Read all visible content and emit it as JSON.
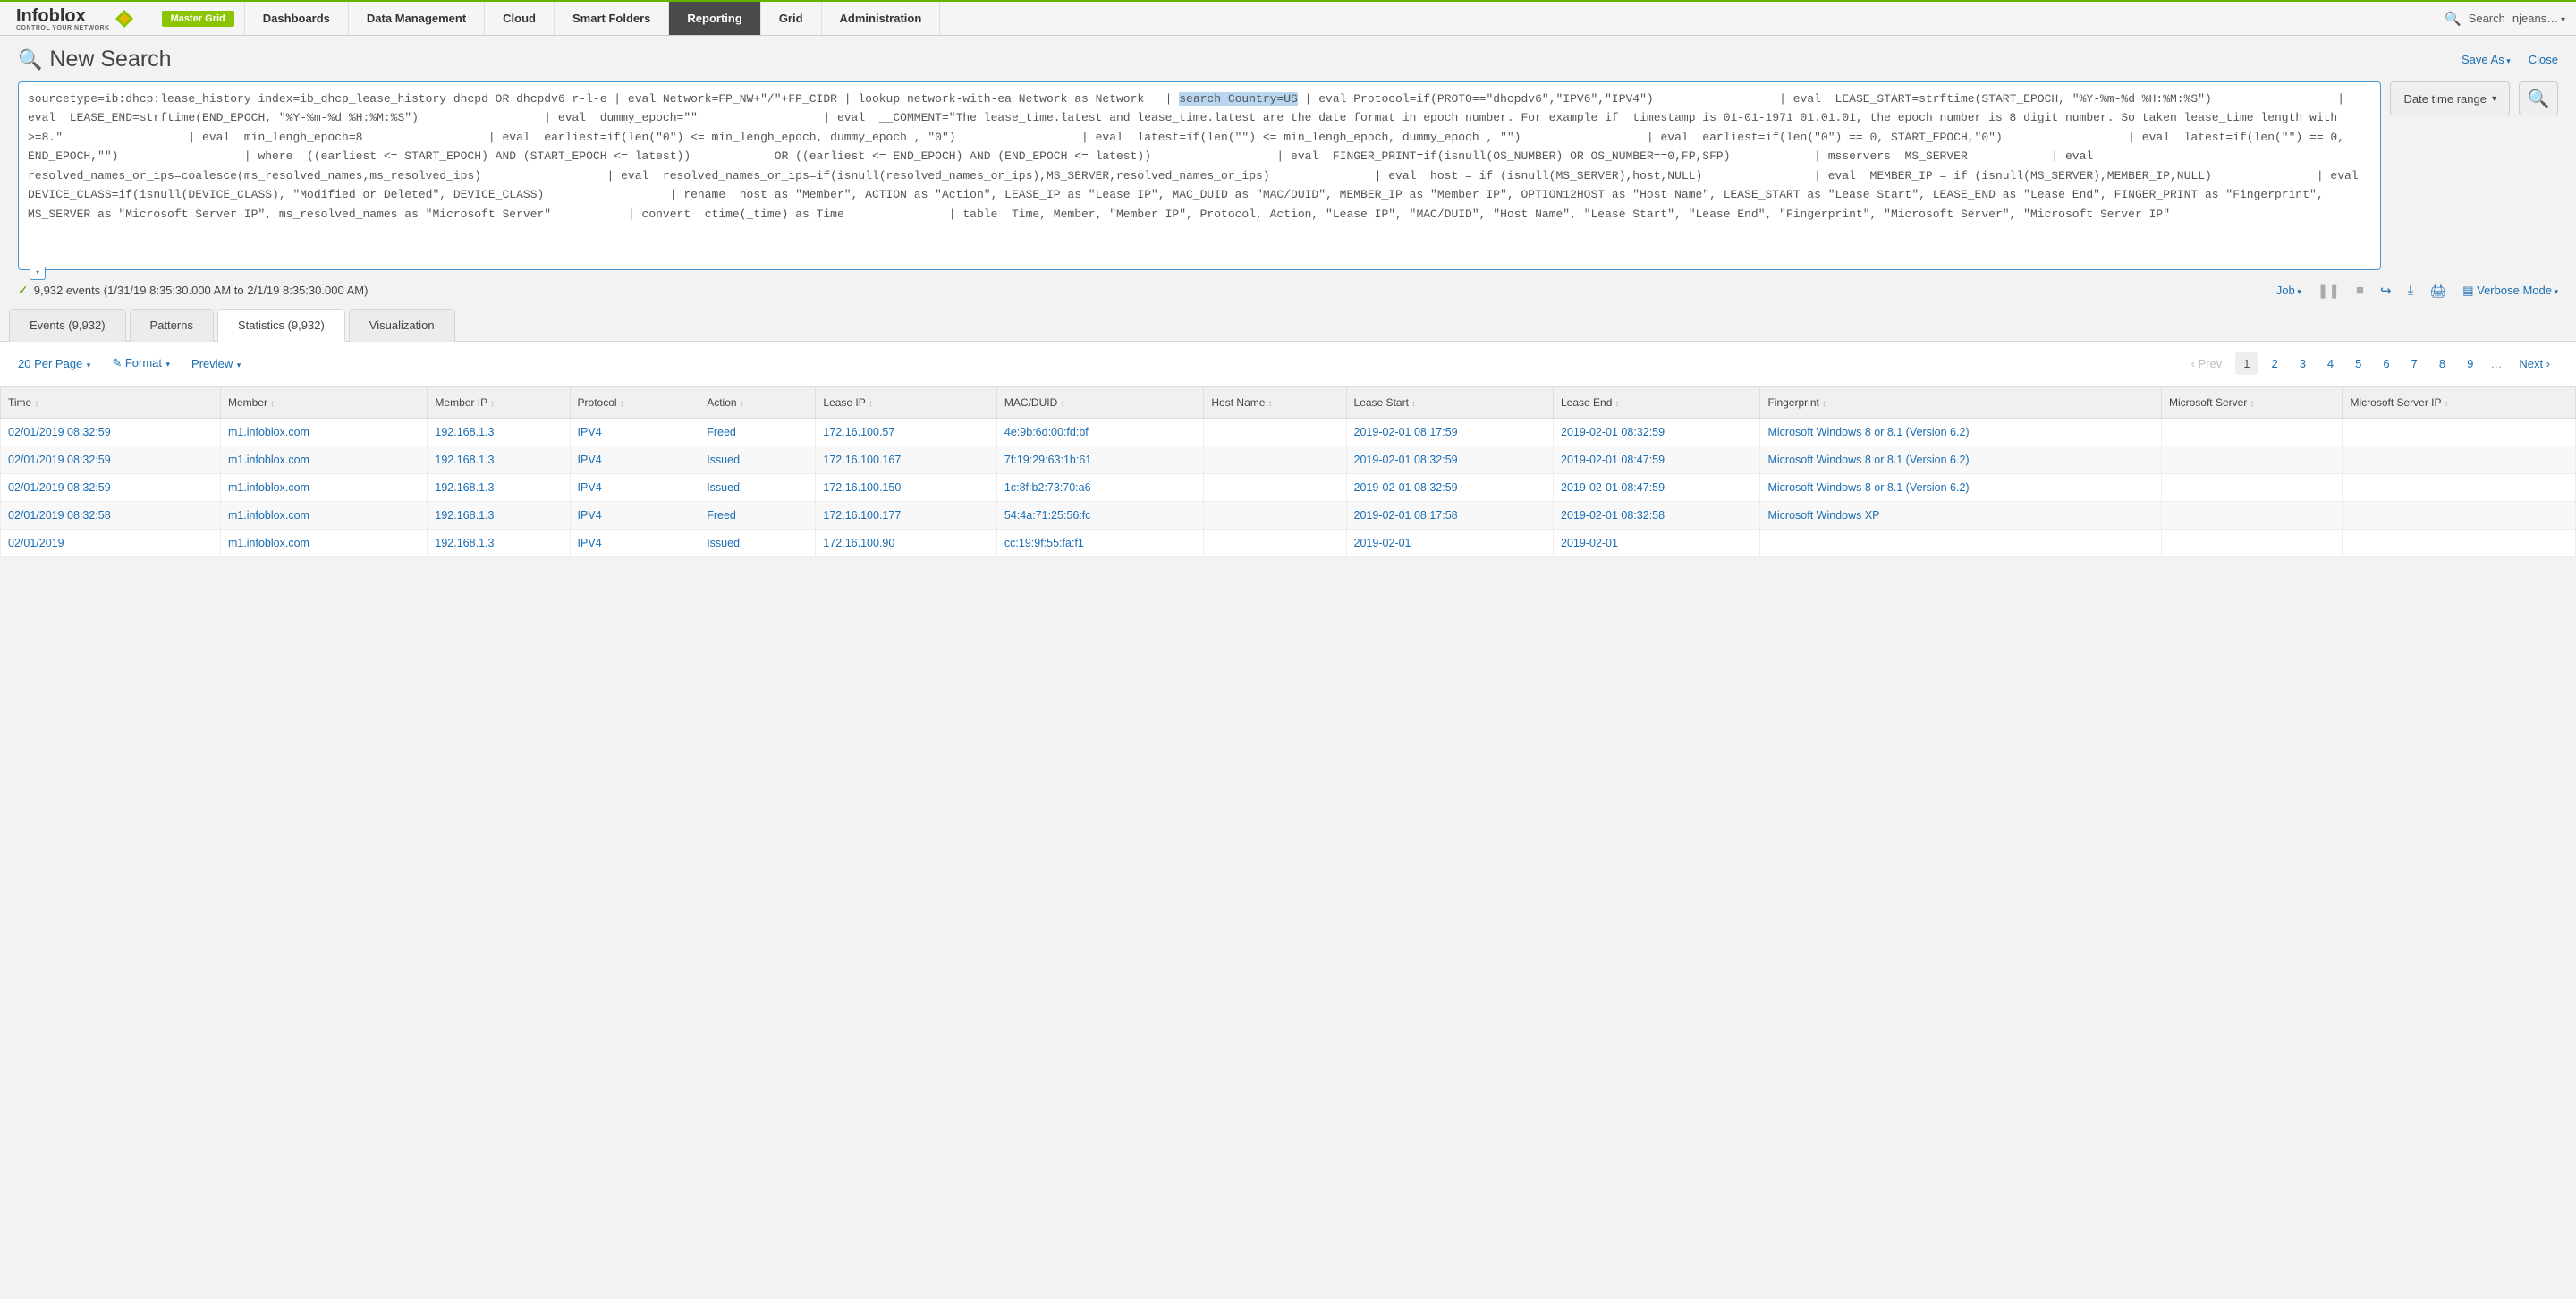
{
  "brand": {
    "name": "Infoblox",
    "tagline": "CONTROL YOUR NETWORK"
  },
  "master_grid_label": "Master Grid",
  "nav": [
    "Dashboards",
    "Data Management",
    "Cloud",
    "Smart Folders",
    "Reporting",
    "Grid",
    "Administration"
  ],
  "nav_active": "Reporting",
  "top_search_label": "Search",
  "user": "njeans…",
  "page_title": "New Search",
  "header_actions": {
    "save_as": "Save As",
    "close": "Close"
  },
  "search_query_pre": "sourcetype=ib:dhcp:lease_history index=ib_dhcp_lease_history dhcpd OR dhcpdv6 r-l-e | eval Network=FP_NW+\"/\"+FP_CIDR | lookup network-with-ea Network as Network   | ",
  "search_query_hl": "search Country=US",
  "search_query_post": " | eval Protocol=if(PROTO==\"dhcpdv6\",\"IPV6\",\"IPV4\")                  | eval  LEASE_START=strftime(START_EPOCH, \"%Y-%m-%d %H:%M:%S\")                  | eval  LEASE_END=strftime(END_EPOCH, \"%Y-%m-%d %H:%M:%S\")                  | eval  dummy_epoch=\"\"                  | eval  __COMMENT=\"The lease_time.latest and lease_time.latest are the date format in epoch number. For example if  timestamp is 01-01-1971 01.01.01, the epoch number is 8 digit number. So taken lease_time length with >=8.\"                  | eval  min_lengh_epoch=8                  | eval  earliest=if(len(\"0\") <= min_lengh_epoch, dummy_epoch , \"0\")                  | eval  latest=if(len(\"\") <= min_lengh_epoch, dummy_epoch , \"\")                  | eval  earliest=if(len(\"0\") == 0, START_EPOCH,\"0\")                  | eval  latest=if(len(\"\") == 0, END_EPOCH,\"\")                  | where  ((earliest <= START_EPOCH) AND (START_EPOCH <= latest))            OR ((earliest <= END_EPOCH) AND (END_EPOCH <= latest))                  | eval  FINGER_PRINT=if(isnull(OS_NUMBER) OR OS_NUMBER==0,FP,SFP)            | msservers  MS_SERVER            | eval  resolved_names_or_ips=coalesce(ms_resolved_names,ms_resolved_ips)                  | eval  resolved_names_or_ips=if(isnull(resolved_names_or_ips),MS_SERVER,resolved_names_or_ips)               | eval  host = if (isnull(MS_SERVER),host,NULL)                | eval  MEMBER_IP = if (isnull(MS_SERVER),MEMBER_IP,NULL)               | eval  DEVICE_CLASS=if(isnull(DEVICE_CLASS), \"Modified or Deleted\", DEVICE_CLASS)                  | rename  host as \"Member\", ACTION as \"Action\", LEASE_IP as \"Lease IP\", MAC_DUID as \"MAC/DUID\", MEMBER_IP as \"Member IP\", OPTION12HOST as \"Host Name\", LEASE_START as \"Lease Start\", LEASE_END as \"Lease End\", FINGER_PRINT as \"Fingerprint\", MS_SERVER as \"Microsoft Server IP\", ms_resolved_names as \"Microsoft Server\"           | convert  ctime(_time) as Time               | table  Time, Member, \"Member IP\", Protocol, Action, \"Lease IP\", \"MAC/DUID\", \"Host Name\", \"Lease Start\", \"Lease End\", \"Fingerprint\", \"Microsoft Server\", \"Microsoft Server IP\"",
  "time_range_label": "Date time range",
  "events_summary": "9,932 events (1/31/19 8:35:30.000 AM to 2/1/19 8:35:30.000 AM)",
  "job_label": "Job",
  "verbose_label": "Verbose Mode",
  "result_tabs": {
    "events": "Events (9,932)",
    "patterns": "Patterns",
    "statistics": "Statistics (9,932)",
    "visualization": "Visualization"
  },
  "result_tab_active": "statistics",
  "toolbar": {
    "per_page": "20 Per Page",
    "format": "Format",
    "preview": "Preview"
  },
  "pager": {
    "prev": "Prev",
    "pages": [
      "1",
      "2",
      "3",
      "4",
      "5",
      "6",
      "7",
      "8",
      "9"
    ],
    "next": "Next",
    "current": "1"
  },
  "columns": [
    "Time",
    "Member",
    "Member IP",
    "Protocol",
    "Action",
    "Lease IP",
    "MAC/DUID",
    "Host Name",
    "Lease Start",
    "Lease End",
    "Fingerprint",
    "Microsoft Server",
    "Microsoft Server IP"
  ],
  "rows": [
    {
      "time": "02/01/2019 08:32:59",
      "member": "m1.infoblox.com",
      "mip": "192.168.1.3",
      "proto": "IPV4",
      "action": "Freed",
      "lip": "172.16.100.57",
      "mac": "4e:9b:6d:00:fd:bf",
      "host": "",
      "ls": "2019-02-01 08:17:59",
      "le": "2019-02-01 08:32:59",
      "fp": "Microsoft Windows 8 or 8.1 (Version 6.2)",
      "ms": "",
      "msip": ""
    },
    {
      "time": "02/01/2019 08:32:59",
      "member": "m1.infoblox.com",
      "mip": "192.168.1.3",
      "proto": "IPV4",
      "action": "Issued",
      "lip": "172.16.100.167",
      "mac": "7f:19:29:63:1b:61",
      "host": "",
      "ls": "2019-02-01 08:32:59",
      "le": "2019-02-01 08:47:59",
      "fp": "Microsoft Windows 8 or 8.1 (Version 6.2)",
      "ms": "",
      "msip": ""
    },
    {
      "time": "02/01/2019 08:32:59",
      "member": "m1.infoblox.com",
      "mip": "192.168.1.3",
      "proto": "IPV4",
      "action": "Issued",
      "lip": "172.16.100.150",
      "mac": "1c:8f:b2:73:70:a6",
      "host": "",
      "ls": "2019-02-01 08:32:59",
      "le": "2019-02-01 08:47:59",
      "fp": "Microsoft Windows 8 or 8.1 (Version 6.2)",
      "ms": "",
      "msip": ""
    },
    {
      "time": "02/01/2019 08:32:58",
      "member": "m1.infoblox.com",
      "mip": "192.168.1.3",
      "proto": "IPV4",
      "action": "Freed",
      "lip": "172.16.100.177",
      "mac": "54:4a:71:25:56:fc",
      "host": "",
      "ls": "2019-02-01 08:17:58",
      "le": "2019-02-01 08:32:58",
      "fp": "Microsoft Windows XP",
      "ms": "",
      "msip": ""
    },
    {
      "time": "02/01/2019",
      "member": "m1.infoblox.com",
      "mip": "192.168.1.3",
      "proto": "IPV4",
      "action": "Issued",
      "lip": "172.16.100.90",
      "mac": "cc:19:9f:55:fa:f1",
      "host": "",
      "ls": "2019-02-01",
      "le": "2019-02-01",
      "fp": "",
      "ms": "",
      "msip": ""
    }
  ]
}
